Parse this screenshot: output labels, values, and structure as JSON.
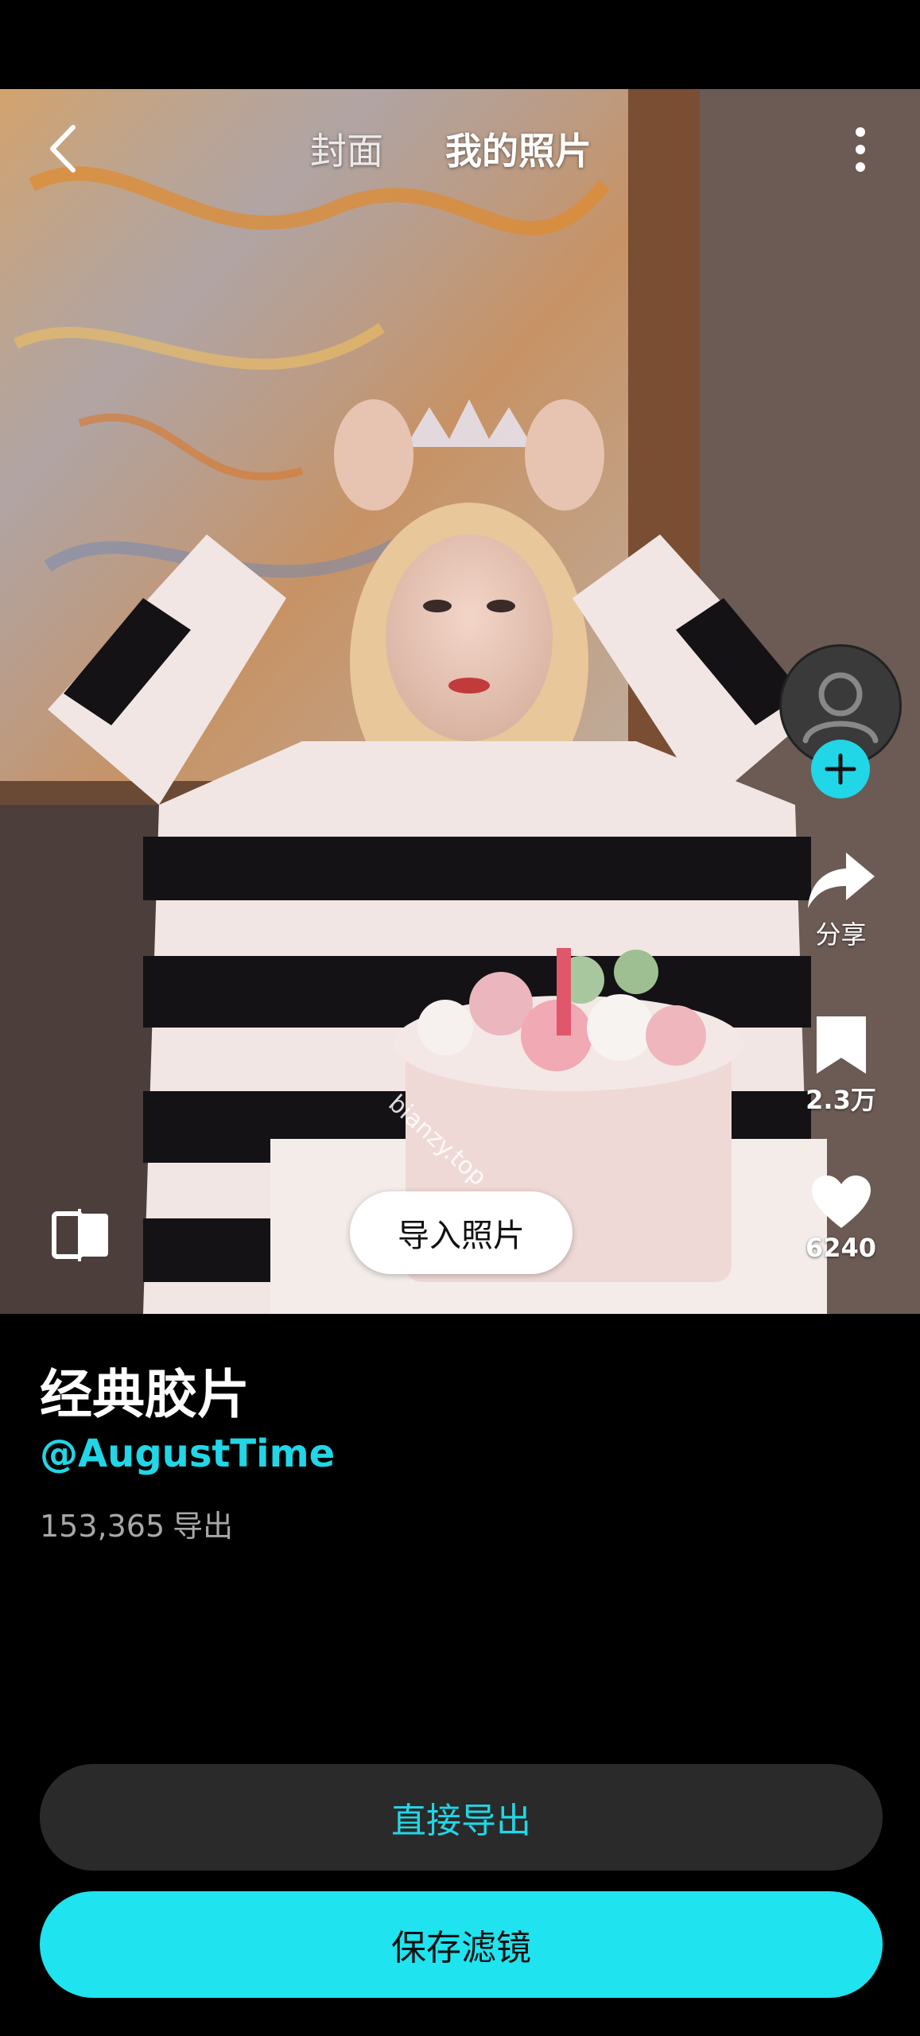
{
  "topbar": {
    "tab_cover": "封面",
    "tab_my_photos": "我的照片"
  },
  "actions": {
    "share_label": "分享",
    "save_count": "2.3万",
    "like_count": "6240"
  },
  "preview": {
    "import_label": "导入照片",
    "watermark": "bianzy.top"
  },
  "filter": {
    "name": "经典胶片",
    "author": "@AugustTime",
    "export_count": "153,365",
    "export_label": "导出"
  },
  "buttons": {
    "direct_export": "直接导出",
    "save_filter": "保存滤镜"
  },
  "colors": {
    "accent": "#21d6e6",
    "background": "#000000",
    "secondary_button": "#2a2a2a"
  }
}
